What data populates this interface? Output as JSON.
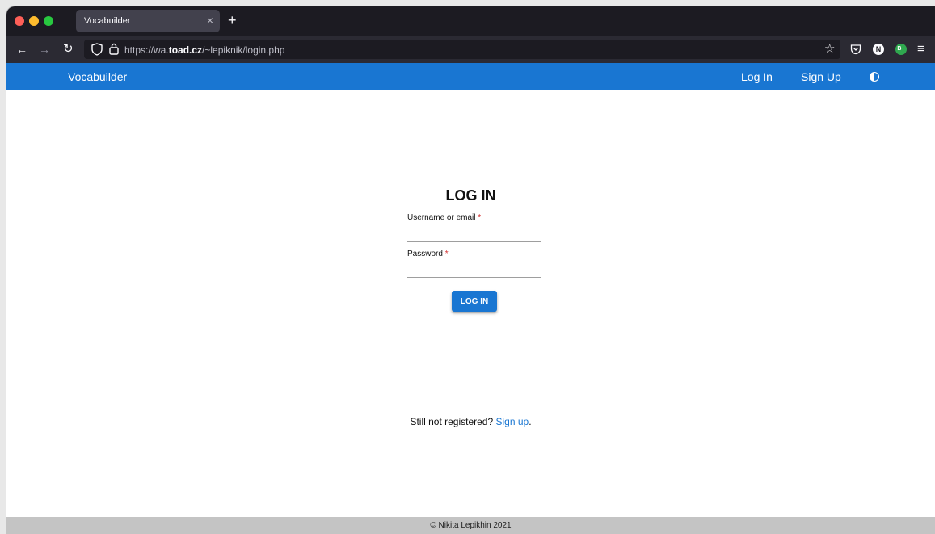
{
  "browser": {
    "tab_title": "Vocabuilder",
    "tab_close": "×",
    "new_tab": "+",
    "url_prefix": "https://wa.",
    "url_domain": "toad.cz",
    "url_path": "/~lepiknik/login.php"
  },
  "app": {
    "brand": "Vocabuilder",
    "nav": {
      "login": "Log In",
      "signup": "Sign Up"
    },
    "accent_color": "#1976d2"
  },
  "login": {
    "title": "LOG IN",
    "username_label": "Username or email",
    "password_label": "Password",
    "required_mark": "*",
    "username_value": "",
    "password_value": "",
    "button_label": "LOG IN"
  },
  "register": {
    "prompt": "Still not registered?",
    "link_text": "Sign up",
    "suffix": "."
  },
  "footer": {
    "copyright": "© Nikita Lepikhin 2021"
  },
  "extensions": {
    "n_badge": "N",
    "b_badge": "B+"
  }
}
